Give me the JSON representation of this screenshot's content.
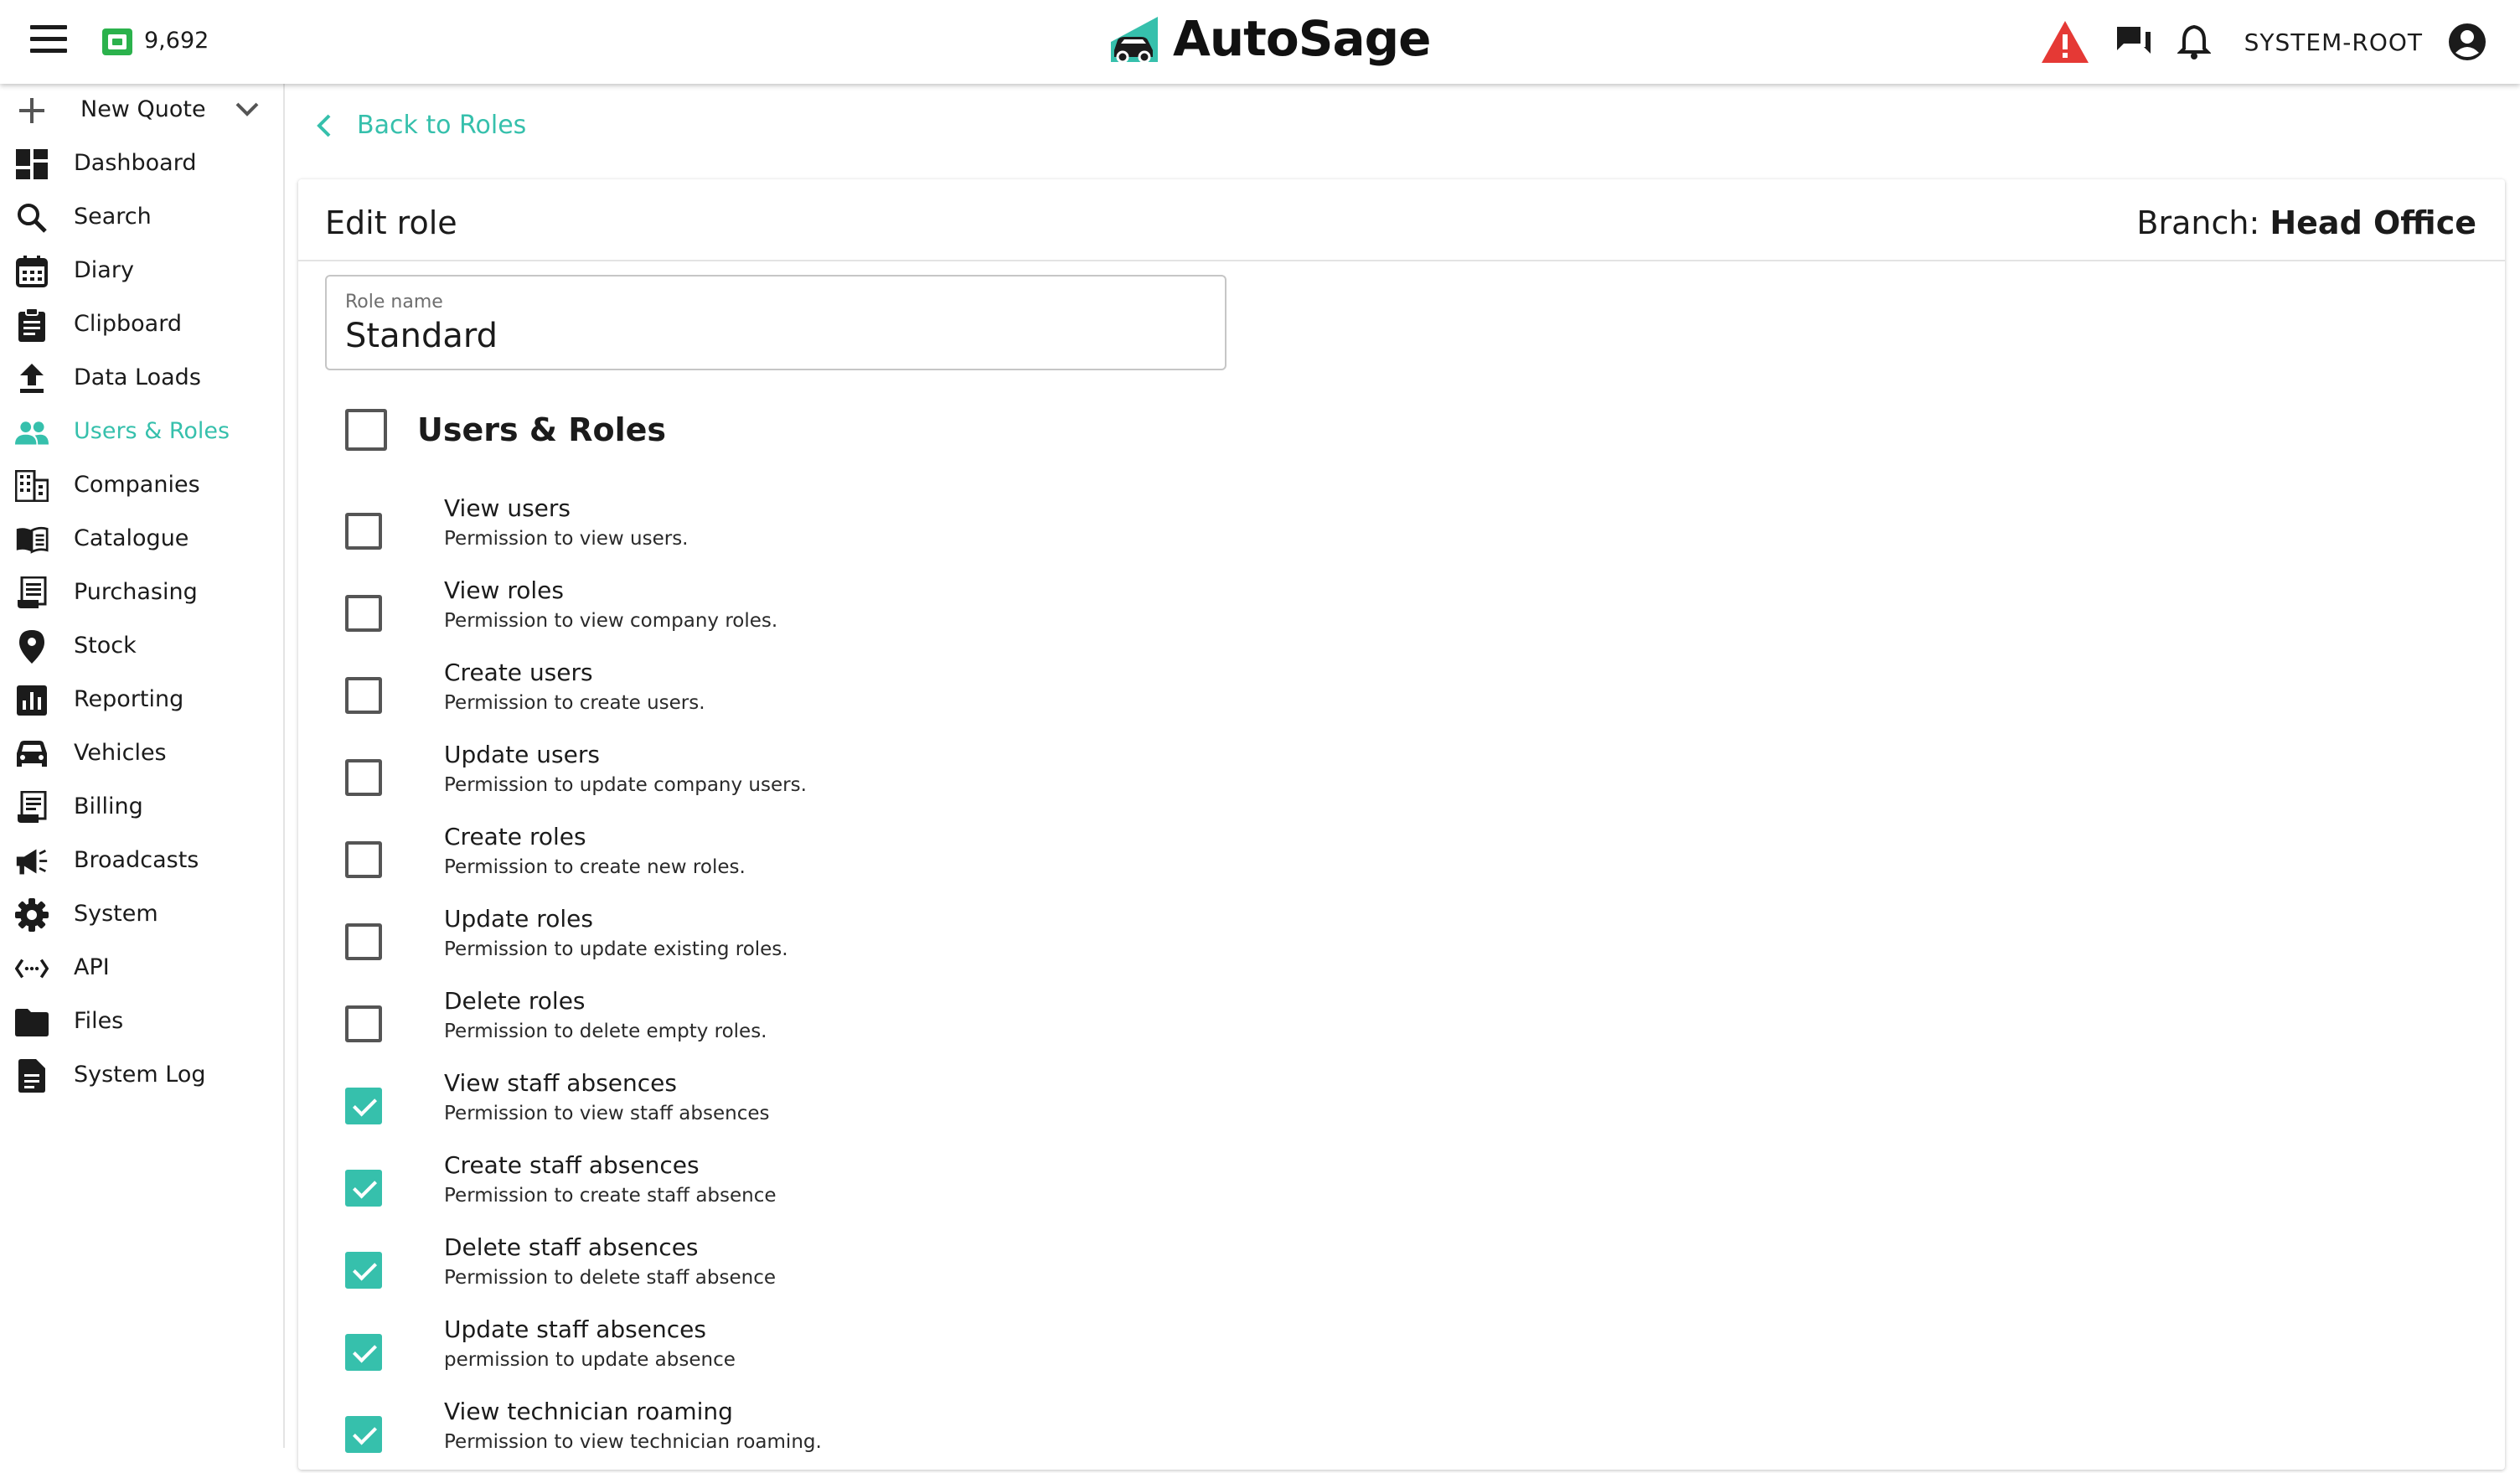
{
  "topbar": {
    "credits": "9,692",
    "brand": "AutoSage",
    "user": "SYSTEM-ROOT",
    "alert_color": "#e53935",
    "accent": "#36c0ac"
  },
  "sidebar": {
    "new_quote": "New Quote",
    "items": [
      {
        "label": "Dashboard",
        "icon": "dashboard-icon"
      },
      {
        "label": "Search",
        "icon": "search-icon"
      },
      {
        "label": "Diary",
        "icon": "calendar-icon"
      },
      {
        "label": "Clipboard",
        "icon": "clipboard-icon"
      },
      {
        "label": "Data Loads",
        "icon": "upload-icon"
      },
      {
        "label": "Users & Roles",
        "icon": "people-icon",
        "active": true
      },
      {
        "label": "Companies",
        "icon": "building-icon"
      },
      {
        "label": "Catalogue",
        "icon": "book-icon"
      },
      {
        "label": "Purchasing",
        "icon": "receipt-icon"
      },
      {
        "label": "Stock",
        "icon": "location-pin-icon"
      },
      {
        "label": "Reporting",
        "icon": "bar-chart-icon"
      },
      {
        "label": "Vehicles",
        "icon": "car-icon"
      },
      {
        "label": "Billing",
        "icon": "invoice-icon"
      },
      {
        "label": "Broadcasts",
        "icon": "megaphone-icon"
      },
      {
        "label": "System",
        "icon": "gear-icon"
      },
      {
        "label": "API",
        "icon": "api-icon"
      },
      {
        "label": "Files",
        "icon": "folder-icon"
      },
      {
        "label": "System Log",
        "icon": "document-icon"
      }
    ]
  },
  "main": {
    "back_label": "Back to Roles",
    "title": "Edit role",
    "branch_prefix": "Branch:",
    "branch_name": "Head Office",
    "role_field": {
      "label": "Role name",
      "value": "Standard"
    },
    "group_title": "Users & Roles",
    "permissions": [
      {
        "title": "View users",
        "desc": "Permission to view users.",
        "checked": false
      },
      {
        "title": "View roles",
        "desc": "Permission to view company roles.",
        "checked": false
      },
      {
        "title": "Create users",
        "desc": "Permission to create users.",
        "checked": false
      },
      {
        "title": "Update users",
        "desc": "Permission to update company users.",
        "checked": false
      },
      {
        "title": "Create roles",
        "desc": "Permission to create new roles.",
        "checked": false
      },
      {
        "title": "Update roles",
        "desc": "Permission to update existing roles.",
        "checked": false
      },
      {
        "title": "Delete roles",
        "desc": "Permission to delete empty roles.",
        "checked": false
      },
      {
        "title": "View staff absences",
        "desc": "Permission to view staff absences",
        "checked": true
      },
      {
        "title": "Create staff absences",
        "desc": "Permission to create staff absence",
        "checked": true
      },
      {
        "title": "Delete staff absences",
        "desc": "Permission to delete staff absence",
        "checked": true
      },
      {
        "title": "Update staff absences",
        "desc": "permission to update absence",
        "checked": true
      },
      {
        "title": "View technician roaming",
        "desc": "Permission to view technician roaming.",
        "checked": true
      }
    ]
  }
}
